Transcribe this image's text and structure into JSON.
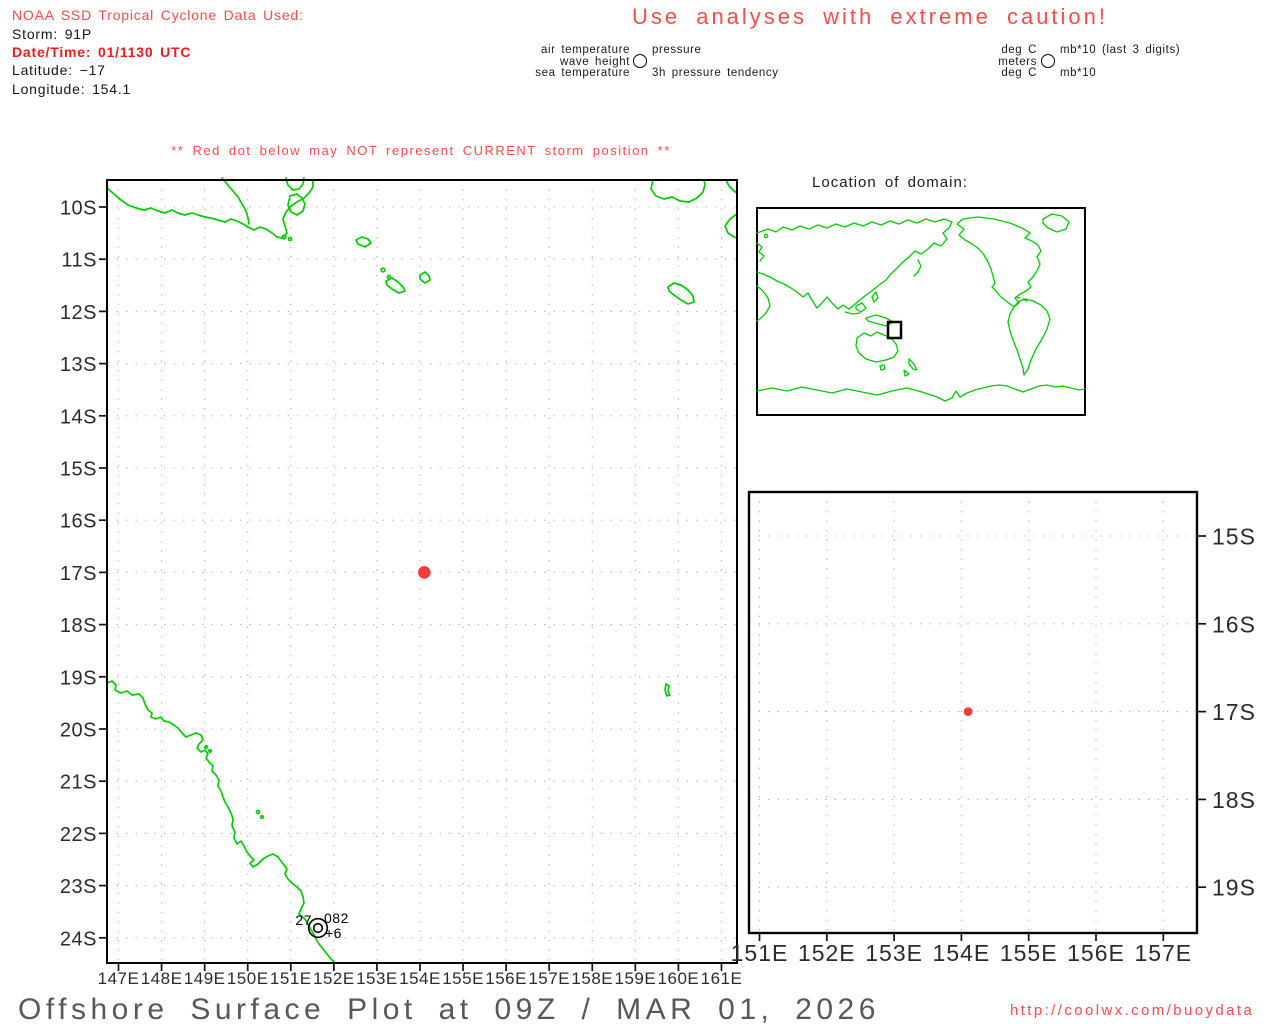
{
  "header": {
    "source_line": "NOAA SSD Tropical Cyclone Data Used:",
    "storm_line": "Storm: 91P",
    "datetime_line": "Date/Time: 01/1130 UTC",
    "latitude_line": "Latitude: −17",
    "longitude_line": "Longitude: 154.1"
  },
  "caution_banner": "Use analyses with extreme caution!",
  "station_legend": {
    "air_temperature": "air temperature",
    "wave_height": "wave height",
    "sea_temperature": "sea temperature",
    "pressure": "pressure",
    "pressure_tendency": "3h pressure tendency"
  },
  "units_legend": {
    "air_temperature": "deg C",
    "wave_height": "meters",
    "sea_temperature": "deg C",
    "pressure": "mb*10 (last 3 digits)",
    "pressure_tendency": "mb*10"
  },
  "storm_warning": "** Red dot below may NOT represent CURRENT storm position **",
  "world_inset_title": "Location of domain:",
  "main_map": {
    "lon_ticks": [
      "147E",
      "148E",
      "149E",
      "150E",
      "151E",
      "152E",
      "153E",
      "154E",
      "155E",
      "156E",
      "157E",
      "158E",
      "159E",
      "160E",
      "161E"
    ],
    "lat_ticks": [
      "10S",
      "11S",
      "12S",
      "13S",
      "14S",
      "15S",
      "16S",
      "17S",
      "18S",
      "19S",
      "20S",
      "21S",
      "22S",
      "23S",
      "24S"
    ],
    "storm_position": {
      "lon": 154.1,
      "lat": -17
    },
    "station_report": {
      "air_temperature": "27",
      "pressure": "082",
      "pressure_tendency": "+6"
    }
  },
  "detail_map": {
    "lon_ticks": [
      "151E",
      "152E",
      "153E",
      "154E",
      "155E",
      "156E",
      "157E"
    ],
    "lat_ticks": [
      "15S",
      "16S",
      "17S",
      "18S",
      "19S"
    ],
    "storm_position": {
      "lon": 154.1,
      "lat": -17
    }
  },
  "footer": {
    "title": "Offshore Surface Plot at 09Z / MAR 01, 2026",
    "url": "http://coolwx.com/buoydata"
  },
  "colors": {
    "coast_green": "#00cc00",
    "storm_red": "#f53b3b",
    "banner_red": "#fa4b4b",
    "strong_red": "#ee1c1c"
  }
}
